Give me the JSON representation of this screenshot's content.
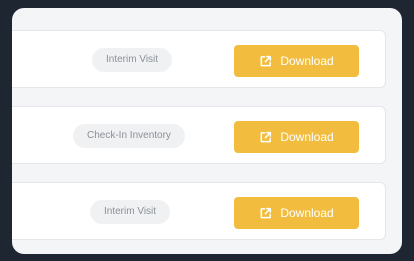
{
  "rows": [
    {
      "type_label": "Interim Visit",
      "action_label": "Download",
      "action_icon": "external-link-icon"
    },
    {
      "type_label": "Check-In Inventory",
      "action_label": "Download",
      "action_icon": "external-link-icon"
    },
    {
      "type_label": "Interim Visit",
      "action_label": "Download",
      "action_icon": "external-link-icon"
    }
  ],
  "colors": {
    "accent": "#f2bd3f",
    "background": "#1e2632",
    "panel": "#f4f5f7",
    "badge_bg": "#f0f1f3",
    "badge_text": "#8a9099"
  }
}
